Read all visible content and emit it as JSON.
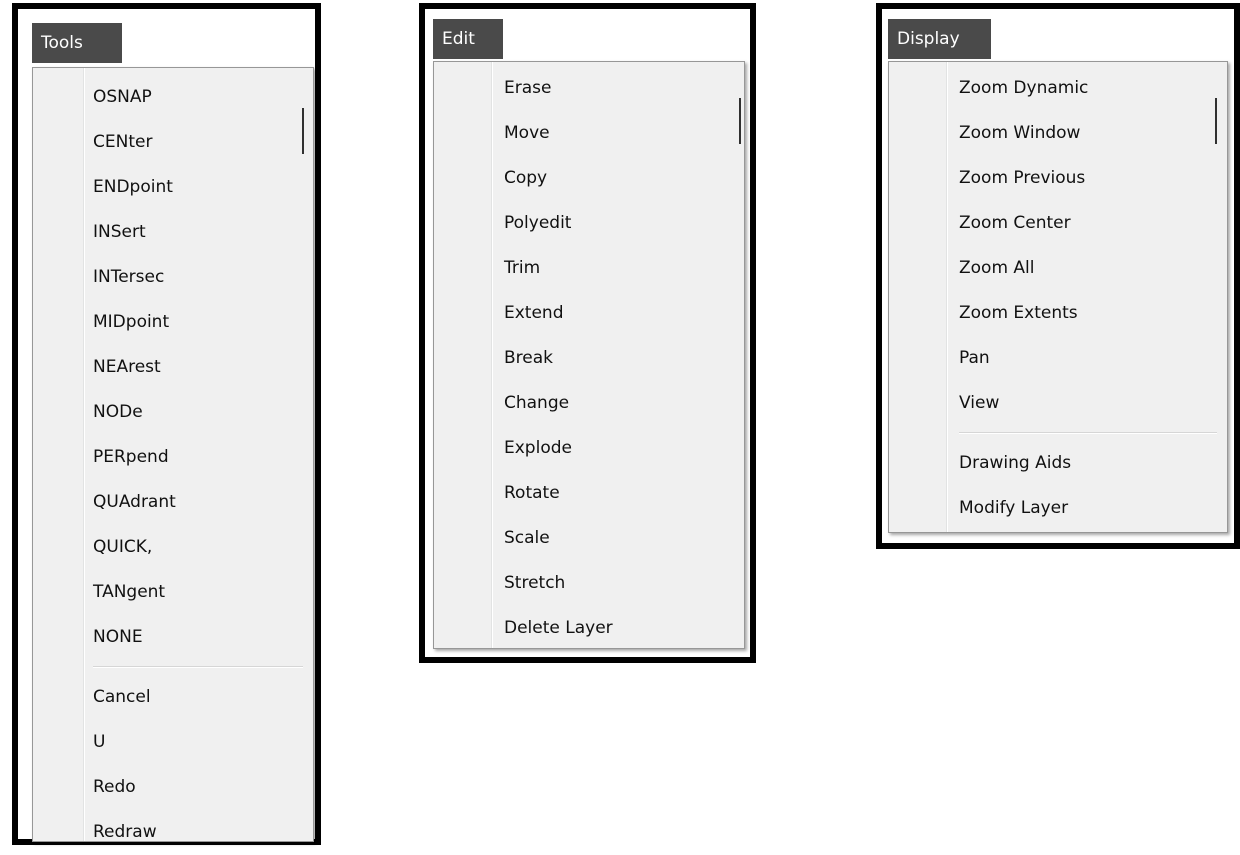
{
  "tools": {
    "title": "Tools",
    "items": [
      "OSNAP",
      "CENter",
      "ENDpoint",
      "INSert",
      "INTersec",
      "MIDpoint",
      "NEArest",
      "NODe",
      "PERpend",
      "QUAdrant",
      "QUICK,",
      "TANgent",
      "NONE"
    ],
    "items2": [
      "Cancel",
      "U",
      "Redo",
      "Redraw"
    ]
  },
  "edit": {
    "title": "Edit",
    "items": [
      "Erase",
      "Move",
      "Copy",
      "Polyedit",
      "Trim",
      "Extend",
      "Break",
      "Change",
      "Explode",
      "Rotate",
      "Scale",
      "Stretch",
      "Delete Layer"
    ]
  },
  "display": {
    "title": "Display",
    "items": [
      "Zoom Dynamic",
      "Zoom Window",
      "Zoom Previous",
      "Zoom Center",
      "Zoom All",
      "Zoom Extents",
      "Pan",
      "View"
    ],
    "items2": [
      "Drawing Aids",
      "Modify Layer"
    ]
  }
}
